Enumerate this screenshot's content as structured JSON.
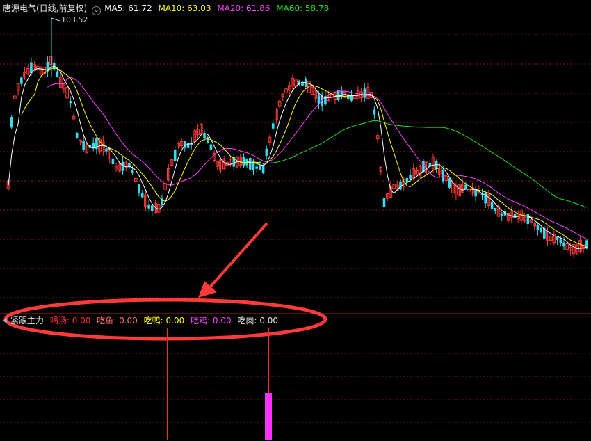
{
  "main_panel": {
    "stock_title": "唐源电气(日线,前复权)",
    "ma": [
      {
        "label": "MA5: 61.72",
        "color": "#ffffff"
      },
      {
        "label": "MA10: 63.03",
        "color": "#ffff00"
      },
      {
        "label": "MA20: 61.86",
        "color": "#ff44ff"
      },
      {
        "label": "MA60: 58.78",
        "color": "#22dd22"
      }
    ],
    "peak_price_label": "103.52"
  },
  "indicator_panel": {
    "name": "紧跟主力",
    "values": [
      {
        "label": "喝汤: 0.00",
        "color": "#ff3030"
      },
      {
        "label": "吃鱼: 0.00",
        "color": "#ff7070"
      },
      {
        "label": "吃鸭: 0.00",
        "color": "#ffff00"
      },
      {
        "label": "吃鸡: 0.00",
        "color": "#ff44ff"
      },
      {
        "label": "吃肉: 0.00",
        "color": "#e0e0e0"
      }
    ]
  },
  "colors": {
    "up": "#ff3b3b",
    "down": "#33ddee",
    "grid": "#8b1a1a",
    "annotation": "#ff3a3a",
    "bar_magenta": "#ff33ff"
  }
}
